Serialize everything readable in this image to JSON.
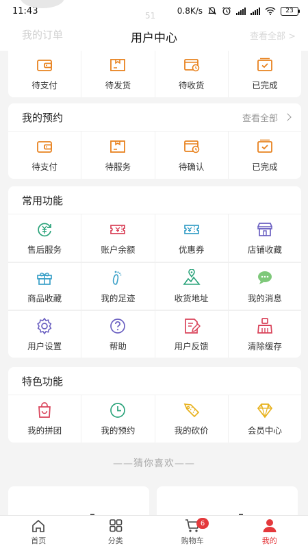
{
  "status_bar": {
    "time": "11:43",
    "speed": "0.8K/s",
    "battery": "23",
    "bg_badge": "51"
  },
  "header": {
    "title": "用户中心",
    "ghost_left": "我的订单",
    "ghost_right": "查看全部 >"
  },
  "orders": {
    "items": [
      {
        "label": "待支付",
        "icon": "wallet-icon"
      },
      {
        "label": "待发货",
        "icon": "package-icon"
      },
      {
        "label": "待收货",
        "icon": "truck-clock-icon"
      },
      {
        "label": "已完成",
        "icon": "completed-box-icon"
      }
    ]
  },
  "appointments": {
    "title": "我的预约",
    "more": "查看全部",
    "items": [
      {
        "label": "待支付",
        "icon": "wallet-icon"
      },
      {
        "label": "待服务",
        "icon": "package-icon"
      },
      {
        "label": "待确认",
        "icon": "truck-clock-icon"
      },
      {
        "label": "已完成",
        "icon": "completed-box-icon"
      }
    ]
  },
  "common": {
    "title": "常用功能",
    "items": [
      {
        "label": "售后服务",
        "icon": "yen-refresh-icon"
      },
      {
        "label": "账户余额",
        "icon": "balance-ticket-icon"
      },
      {
        "label": "优惠券",
        "icon": "coupon-icon"
      },
      {
        "label": "店铺收藏",
        "icon": "store-icon"
      },
      {
        "label": "商品收藏",
        "icon": "gift-icon"
      },
      {
        "label": "我的足迹",
        "icon": "footprint-icon"
      },
      {
        "label": "收货地址",
        "icon": "map-pin-icon"
      },
      {
        "label": "我的消息",
        "icon": "message-icon"
      },
      {
        "label": "用户设置",
        "icon": "gear-icon"
      },
      {
        "label": "帮助",
        "icon": "help-icon"
      },
      {
        "label": "用户反馈",
        "icon": "feedback-icon"
      },
      {
        "label": "清除缓存",
        "icon": "broom-icon"
      }
    ]
  },
  "featured": {
    "title": "特色功能",
    "items": [
      {
        "label": "我的拼团",
        "icon": "group-bag-icon"
      },
      {
        "label": "我的预约",
        "icon": "clock-icon"
      },
      {
        "label": "我的砍价",
        "icon": "bargain-tag-icon"
      },
      {
        "label": "会员中心",
        "icon": "diamond-icon"
      }
    ]
  },
  "recommend": {
    "title": "——猜你喜欢——"
  },
  "tabbar": {
    "items": [
      {
        "label": "首页",
        "icon": "home-icon"
      },
      {
        "label": "分类",
        "icon": "category-grid-icon"
      },
      {
        "label": "购物车",
        "icon": "cart-icon"
      },
      {
        "label": "我的",
        "icon": "user-icon"
      }
    ],
    "cart_count": "6",
    "active": "我的"
  },
  "colors": {
    "accent": "#e4393c",
    "orange": "#e8821f",
    "bg": "#f4f4f4"
  }
}
